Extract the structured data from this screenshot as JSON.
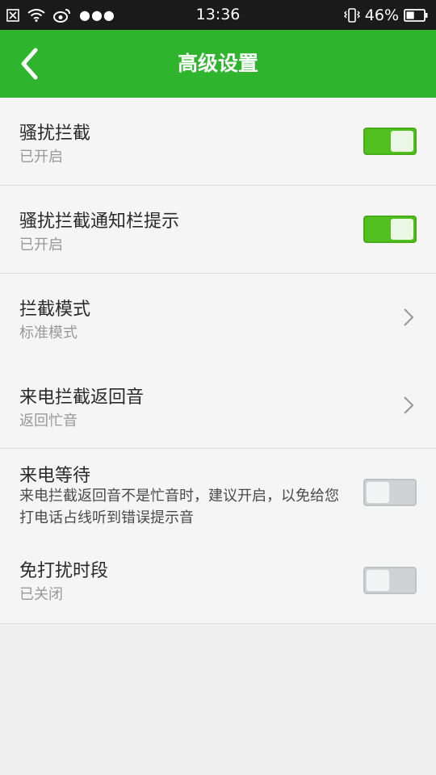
{
  "status_bar": {
    "icons": [
      "notification-x-icon",
      "wifi-icon",
      "weibo-icon",
      "more-dots-icon"
    ],
    "time": "13:36",
    "battery_percent": "46%",
    "battery_level": 0.46,
    "right_icons": [
      "vibrate-icon",
      "battery-icon"
    ]
  },
  "header": {
    "title": "高级设置",
    "back_icon": "back-chevron-icon",
    "color": "#2fb52d"
  },
  "settings": [
    {
      "title": "骚扰拦截",
      "subtitle": "已开启",
      "control": "toggle",
      "on": true
    },
    {
      "title": "骚扰拦截通知栏提示",
      "subtitle": "已开启",
      "control": "toggle",
      "on": true
    },
    {
      "title": "拦截模式",
      "subtitle": "标准模式",
      "control": "chevron"
    },
    {
      "title": "来电拦截返回音",
      "subtitle": "返回忙音",
      "control": "chevron"
    },
    {
      "title": "来电等待",
      "description": "来电拦截返回音不是忙音时，建议开启，以免给您打电话占线听到错误提示音",
      "control": "toggle",
      "on": false
    },
    {
      "title": "免打扰时段",
      "subtitle": "已关闭",
      "control": "toggle",
      "on": false
    }
  ],
  "colors": {
    "toggle_on": "#52c120",
    "toggle_off": "#cfd3d4",
    "background": "#efefef"
  }
}
